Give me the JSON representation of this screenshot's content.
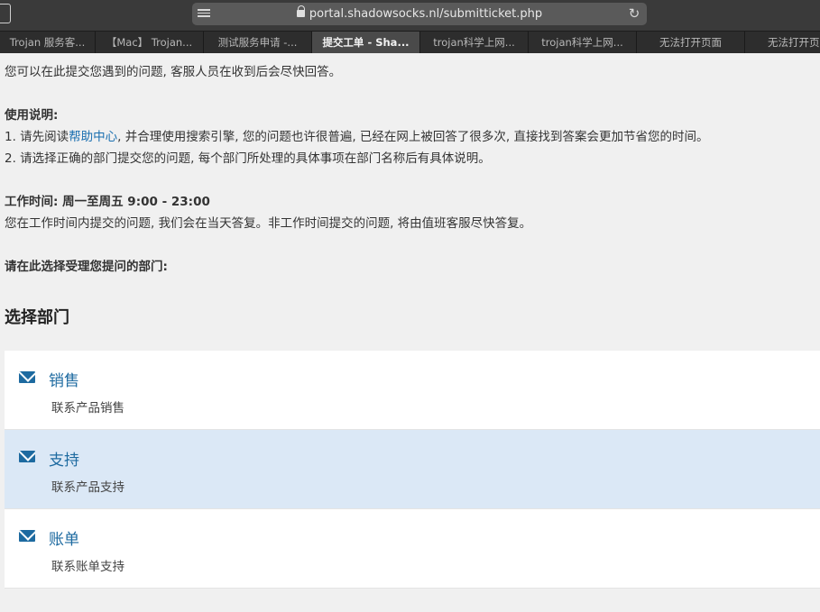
{
  "browser": {
    "url": "portal.shadowsocks.nl/submitticket.php",
    "tabs": [
      {
        "label": "Trojan 服务客..."
      },
      {
        "label": "【Mac】 Trojan..."
      },
      {
        "label": "测试服务申请 -..."
      },
      {
        "label": "提交工单 - Sha..."
      },
      {
        "label": "trojan科学上网..."
      },
      {
        "label": "trojan科学上网..."
      },
      {
        "label": "无法打开页面"
      },
      {
        "label": "无法打开页面"
      }
    ]
  },
  "page": {
    "intro": "您可以在此提交您遇到的问题, 客服人员在收到后会尽快回答。",
    "usage_title": "使用说明:",
    "line1_prefix": "1. 请先阅读",
    "line1_link": "帮助中心",
    "line1_suffix": ", 并合理使用搜索引擎, 您的问题也许很普遍, 已经在网上被回答了很多次, 直接找到答案会更加节省您的时间。",
    "line2": "2. 请选择正确的部门提交您的问题, 每个部门所处理的具体事项在部门名称后有具体说明。",
    "hours_title": "工作时间:  周一至周五 9:00 - 23:00",
    "hours_desc": "您在工作时间内提交的问题, 我们会在当天答复。非工作时间提交的问题, 将由值班客服尽快答复。",
    "choose_prompt": "请在此选择受理您提问的部门:",
    "section_title": "选择部门",
    "departments": [
      {
        "name": "销售",
        "desc": "联系产品销售",
        "icon": "envelope-icon"
      },
      {
        "name": "支持",
        "desc": "联系产品支持",
        "icon": "envelope-icon"
      },
      {
        "name": "账单",
        "desc": "联系账单支持",
        "icon": "envelope-icon"
      }
    ]
  },
  "colors": {
    "accent": "#1d6aa0",
    "highlight_row": "#dbe8f6"
  }
}
